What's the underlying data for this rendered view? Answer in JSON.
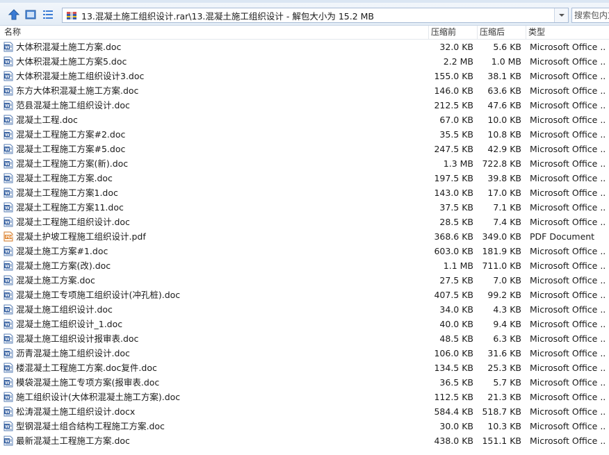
{
  "address": {
    "path": "13.混凝土施工组织设计.rar\\13.混凝土施工组织设计 - 解包大小为 15.2 MB"
  },
  "search": {
    "placeholder": "搜索包内文件"
  },
  "columns": {
    "name": "名称",
    "orig": "压缩前",
    "comp": "压缩后",
    "type": "类型"
  },
  "colors": {
    "word": "#2b579a",
    "pdf": "#e0822b",
    "accent": "#3a7bd5"
  },
  "files": [
    {
      "name": "大体积混凝土施工方案.doc",
      "orig": "32.0 KB",
      "comp": "5.6 KB",
      "type": "Microsoft Office ...",
      "icon": "word-doc-icon"
    },
    {
      "name": "大体积混凝土施工方案5.doc",
      "orig": "2.2 MB",
      "comp": "1.0 MB",
      "type": "Microsoft Office ...",
      "icon": "word-doc-icon"
    },
    {
      "name": "大体积混凝土施工组织设计3.doc",
      "orig": "155.0 KB",
      "comp": "38.1 KB",
      "type": "Microsoft Office ...",
      "icon": "word-doc-icon"
    },
    {
      "name": "东方大体积混凝土施工方案.doc",
      "orig": "146.0 KB",
      "comp": "63.6 KB",
      "type": "Microsoft Office ...",
      "icon": "word-doc-icon"
    },
    {
      "name": "范县混凝土施工组织设计.doc",
      "orig": "212.5 KB",
      "comp": "47.6 KB",
      "type": "Microsoft Office ...",
      "icon": "word-doc-icon"
    },
    {
      "name": "混凝土工程.doc",
      "orig": "67.0 KB",
      "comp": "10.0 KB",
      "type": "Microsoft Office ...",
      "icon": "word-doc-icon"
    },
    {
      "name": "混凝土工程施工方案#2.doc",
      "orig": "35.5 KB",
      "comp": "10.8 KB",
      "type": "Microsoft Office ...",
      "icon": "word-doc-icon"
    },
    {
      "name": "混凝土工程施工方案#5.doc",
      "orig": "247.5 KB",
      "comp": "42.9 KB",
      "type": "Microsoft Office ...",
      "icon": "word-doc-icon"
    },
    {
      "name": "混凝土工程施工方案(新).doc",
      "orig": "1.3 MB",
      "comp": "722.8 KB",
      "type": "Microsoft Office ...",
      "icon": "word-doc-icon"
    },
    {
      "name": "混凝土工程施工方案.doc",
      "orig": "197.5 KB",
      "comp": "39.8 KB",
      "type": "Microsoft Office ...",
      "icon": "word-doc-icon"
    },
    {
      "name": "混凝土工程施工方案1.doc",
      "orig": "143.0 KB",
      "comp": "17.0 KB",
      "type": "Microsoft Office ...",
      "icon": "word-doc-icon"
    },
    {
      "name": "混凝土工程施工方案11.doc",
      "orig": "37.5 KB",
      "comp": "7.1 KB",
      "type": "Microsoft Office ...",
      "icon": "word-doc-icon"
    },
    {
      "name": "混凝土工程施工组织设计.doc",
      "orig": "28.5 KB",
      "comp": "7.4 KB",
      "type": "Microsoft Office ...",
      "icon": "word-doc-icon"
    },
    {
      "name": "混凝土护坡工程施工组织设计.pdf",
      "orig": "368.6 KB",
      "comp": "349.0 KB",
      "type": "PDF Document",
      "icon": "pdf-doc-icon"
    },
    {
      "name": "混凝土施工方案#1.doc",
      "orig": "603.0 KB",
      "comp": "181.9 KB",
      "type": "Microsoft Office ...",
      "icon": "word-doc-icon"
    },
    {
      "name": "混凝土施工方案(改).doc",
      "orig": "1.1 MB",
      "comp": "711.0 KB",
      "type": "Microsoft Office ...",
      "icon": "word-doc-icon"
    },
    {
      "name": "混凝土施工方案.doc",
      "orig": "27.5 KB",
      "comp": "7.0 KB",
      "type": "Microsoft Office ...",
      "icon": "word-doc-icon"
    },
    {
      "name": "混凝土施工专项施工组织设计(冲孔桩).doc",
      "orig": "407.5 KB",
      "comp": "99.2 KB",
      "type": "Microsoft Office ...",
      "icon": "word-doc-icon"
    },
    {
      "name": "混凝土施工组织设计.doc",
      "orig": "34.0 KB",
      "comp": "4.3 KB",
      "type": "Microsoft Office ...",
      "icon": "word-doc-icon"
    },
    {
      "name": "混凝土施工组织设计_1.doc",
      "orig": "40.0 KB",
      "comp": "9.4 KB",
      "type": "Microsoft Office ...",
      "icon": "word-doc-icon"
    },
    {
      "name": "混凝土施工组织设计报审表.doc",
      "orig": "48.5 KB",
      "comp": "6.3 KB",
      "type": "Microsoft Office ...",
      "icon": "word-doc-icon"
    },
    {
      "name": "沥青混凝土施工组织设计.doc",
      "orig": "106.0 KB",
      "comp": "31.6 KB",
      "type": "Microsoft Office ...",
      "icon": "word-doc-icon"
    },
    {
      "name": "楼混凝土工程施工方案.doc复件.doc",
      "orig": "134.5 KB",
      "comp": "25.3 KB",
      "type": "Microsoft Office ...",
      "icon": "word-doc-icon"
    },
    {
      "name": "模袋混凝土施工专项方案(报审表.doc",
      "orig": "36.5 KB",
      "comp": "5.7 KB",
      "type": "Microsoft Office ...",
      "icon": "word-doc-icon"
    },
    {
      "name": "施工组织设计(大体积混凝土施工方案).doc",
      "orig": "112.5 KB",
      "comp": "21.3 KB",
      "type": "Microsoft Office ...",
      "icon": "word-doc-icon"
    },
    {
      "name": "松涛混凝土施工组织设计.docx",
      "orig": "584.4 KB",
      "comp": "518.7 KB",
      "type": "Microsoft Office ...",
      "icon": "word-doc-icon"
    },
    {
      "name": "型钢混凝土组合结构工程施工方案.doc",
      "orig": "30.0 KB",
      "comp": "10.3 KB",
      "type": "Microsoft Office ...",
      "icon": "word-doc-icon"
    },
    {
      "name": "最新混凝土工程施工方案.doc",
      "orig": "438.0 KB",
      "comp": "151.1 KB",
      "type": "Microsoft Office ...",
      "icon": "word-doc-icon"
    }
  ]
}
